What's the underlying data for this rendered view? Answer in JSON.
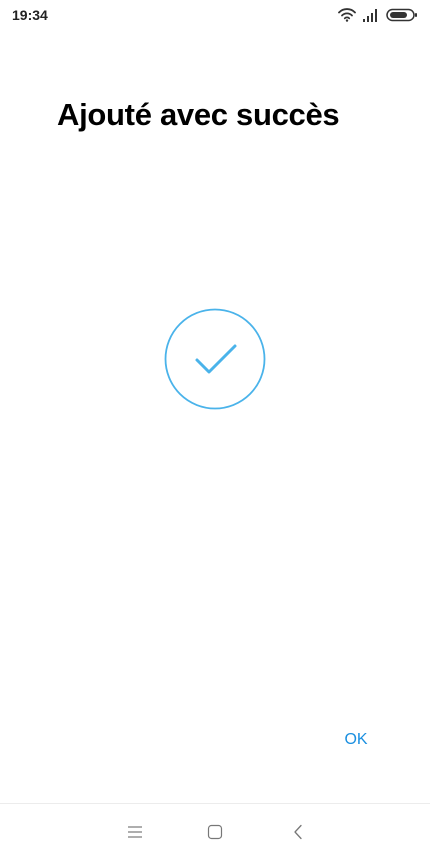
{
  "status_bar": {
    "time": "19:34",
    "icons": [
      "wifi-icon",
      "signal-icon",
      "battery-icon"
    ]
  },
  "main": {
    "title": "Ajouté avec succès",
    "status_icon": "check-circle-icon",
    "ok_label": "OK"
  },
  "nav_bar": {
    "items": [
      "menu-icon",
      "home-icon",
      "back-icon"
    ]
  },
  "colors": {
    "accent": "#1a8fe0",
    "check": "#4ab3ea",
    "text": "#000000",
    "background": "#ffffff"
  }
}
